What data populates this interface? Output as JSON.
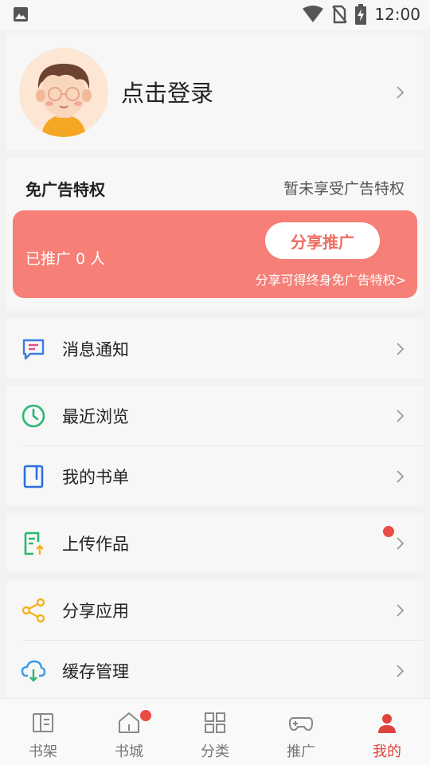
{
  "status_bar": {
    "time": "12:00",
    "left_icon": "image-icon",
    "icons": [
      "wifi-icon",
      "no-sim-icon",
      "battery-charging-icon"
    ]
  },
  "profile": {
    "login_label": "点击登录",
    "avatar_icon": "avatar-boy-glasses"
  },
  "ad_privilege": {
    "title": "免广告特权",
    "status": "暂未享受广告特权",
    "promoted_count": "已推广 0 人",
    "share_button": "分享推广",
    "tip": "分享可得终身免广告特权>"
  },
  "menu": {
    "messages": {
      "label": "消息通知",
      "icon": "message-icon",
      "color": "#3c7be8"
    },
    "recent": {
      "label": "最近浏览",
      "icon": "clock-icon",
      "color": "#2bb673"
    },
    "booklist": {
      "label": "我的书单",
      "icon": "book-icon",
      "color": "#2c6fe0"
    },
    "upload": {
      "label": "上传作品",
      "icon": "upload-doc-icon",
      "color": "#2bb673"
    },
    "share_app": {
      "label": "分享应用",
      "icon": "share-icon",
      "color": "#f2b21c"
    },
    "cache": {
      "label": "缓存管理",
      "icon": "cloud-download-icon",
      "color": "#3a9be6"
    }
  },
  "tabs": [
    {
      "label": "书架",
      "icon": "bookshelf-icon"
    },
    {
      "label": "书城",
      "icon": "home-icon"
    },
    {
      "label": "分类",
      "icon": "category-grid-icon"
    },
    {
      "label": "推广",
      "icon": "gamepad-icon"
    },
    {
      "label": "我的",
      "icon": "user-icon"
    }
  ],
  "colors": {
    "accent": "#e0433d",
    "promo_bg": "#f67f77",
    "badge": "#e94b45"
  }
}
